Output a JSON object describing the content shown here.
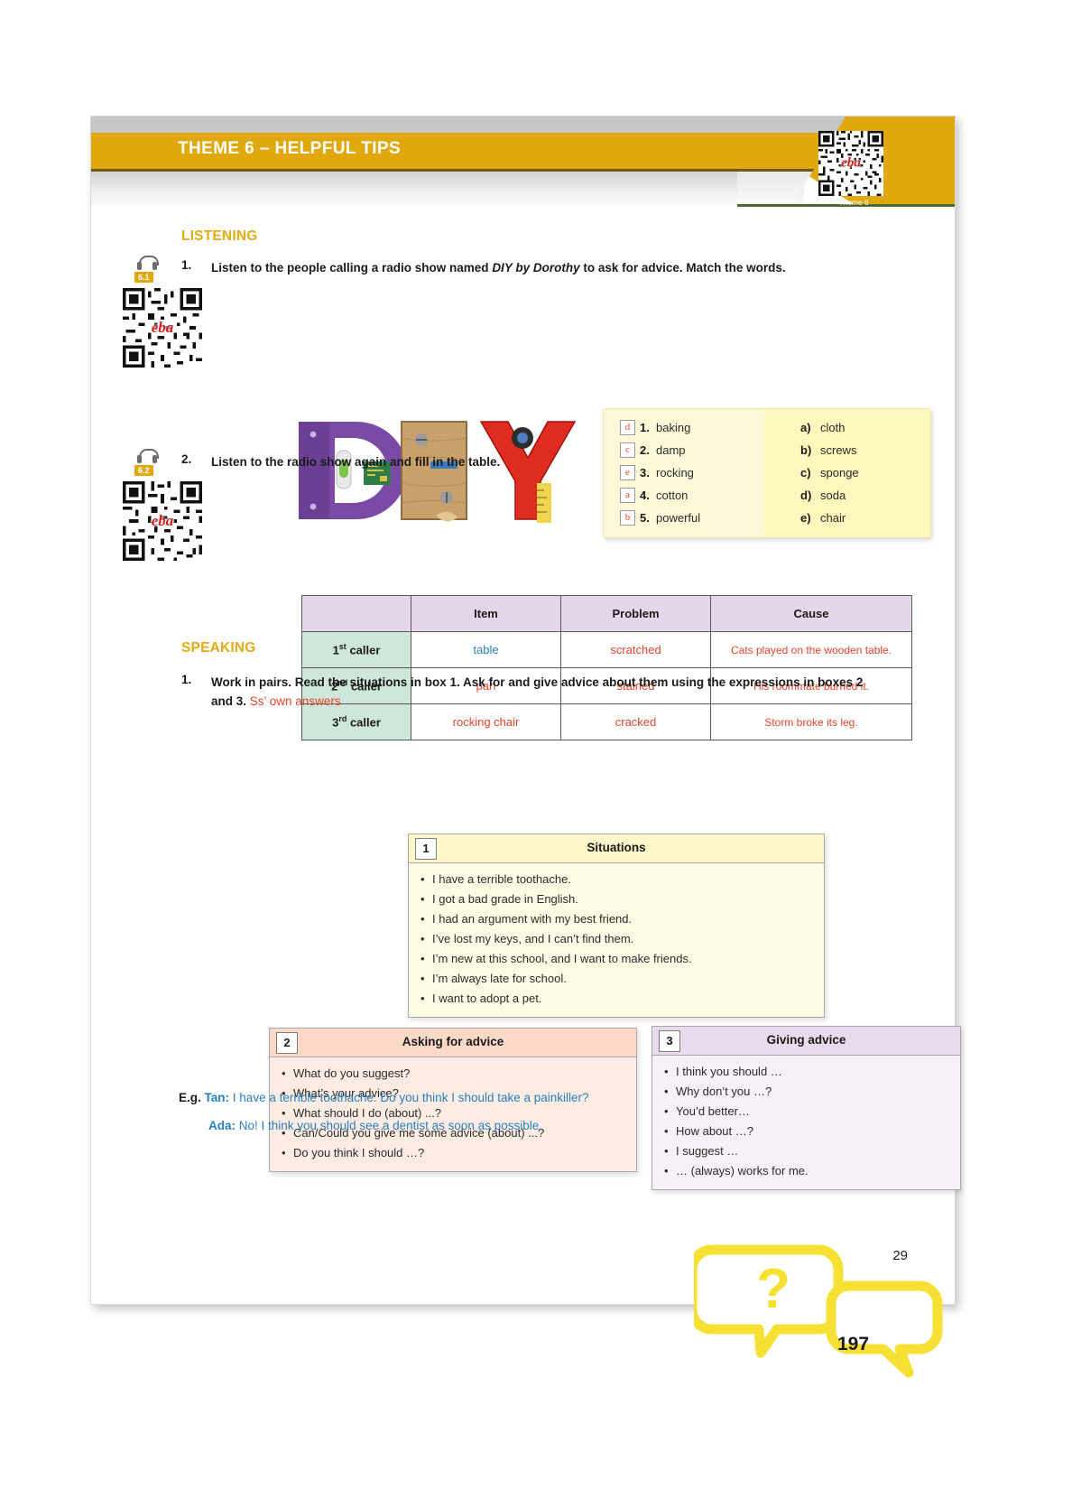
{
  "header": {
    "title": "THEME 6 – HELPFUL TIPS",
    "qr_label": "Theme 6",
    "qr_brand": "eba"
  },
  "colors": {
    "accent_gold": "#e0a80d",
    "heading_gold": "#e0ab15",
    "answer_red": "#e8442a",
    "answer_blue": "#2a7fbf",
    "table_header": "#e4d7ea",
    "table_rowlabel": "#cfe7da"
  },
  "listening": {
    "section_title": "LISTENING",
    "exercise1": {
      "number": "1.",
      "track": "6.1",
      "instruction_html": "Listen to the people calling a radio show named <i>DIY by Dorothy</i> to ask for advice. Match the words.",
      "image_alt": "DIY",
      "left_items": [
        {
          "answer": "d",
          "num": "1.",
          "word": "baking"
        },
        {
          "answer": "c",
          "num": "2.",
          "word": "damp"
        },
        {
          "answer": "e",
          "num": "3.",
          "word": "rocking"
        },
        {
          "answer": "a",
          "num": "4.",
          "word": "cotton"
        },
        {
          "answer": "b",
          "num": "5.",
          "word": "powerful"
        }
      ],
      "right_items": [
        {
          "letter": "a)",
          "word": "cloth"
        },
        {
          "letter": "b)",
          "word": "screws"
        },
        {
          "letter": "c)",
          "word": "sponge"
        },
        {
          "letter": "d)",
          "word": "soda"
        },
        {
          "letter": "e)",
          "word": "chair"
        }
      ]
    },
    "exercise2": {
      "number": "2.",
      "track": "6.2",
      "instruction": "Listen to the radio show again and fill in the table.",
      "table": {
        "headers": [
          "",
          "Item",
          "Problem",
          "Cause"
        ],
        "rows": [
          {
            "label_num": "1",
            "label_sup": "st",
            "label_word": "caller",
            "item": "table",
            "item_color": "blue",
            "problem": "scratched",
            "cause": "Cats played on the wooden table."
          },
          {
            "label_num": "2",
            "label_sup": "nd",
            "label_word": "caller",
            "item": "pan",
            "item_color": "red",
            "problem": "stained",
            "cause": "His roommate burned it."
          },
          {
            "label_num": "3",
            "label_sup": "rd",
            "label_word": "caller",
            "item": "rocking chair",
            "item_color": "red",
            "problem": "cracked",
            "cause": "Storm broke its leg."
          }
        ]
      }
    }
  },
  "speaking": {
    "section_title": "SPEAKING",
    "exercise1": {
      "number": "1.",
      "instruction_line1": "Work in pairs. Read the situations in box 1. Ask for and give advice about them using the",
      "instruction_line2": "expressions in boxes 2 and 3.",
      "answer_note": "Ss’ own answers"
    },
    "box1": {
      "num": "1",
      "title": "Situations",
      "items": [
        "I have a terrible toothache.",
        "I got a bad grade in English.",
        "I had an argument with my best friend.",
        "I’ve lost my keys, and I can’t find them.",
        "I’m new at this school, and I want to make friends.",
        "I’m always late for school.",
        "I want to adopt a pet."
      ]
    },
    "box2": {
      "num": "2",
      "title": "Asking for advice",
      "items": [
        "What do you suggest?",
        "What’s your advice?",
        "What should I do (about) ...?",
        "Can/Could you give me some advice (about) ...?",
        "Do you think I should …?"
      ]
    },
    "box3": {
      "num": "3",
      "title": "Giving advice",
      "items": [
        "I think you should …",
        "Why don’t you …?",
        "You’d better…",
        "How about …?",
        "I suggest …",
        "… (always) works for me."
      ]
    },
    "example": {
      "label": "E.g.",
      "speaker1": "Tan:",
      "line1": "I have a terrible toothache. Do you think I should take a painkiller?",
      "speaker2": "Ada:",
      "line2": "No! I think you should see a dentist as soon as possible."
    },
    "bubble_glyph": "?"
  },
  "page_numbers": {
    "inner": "29",
    "outer": "197"
  }
}
